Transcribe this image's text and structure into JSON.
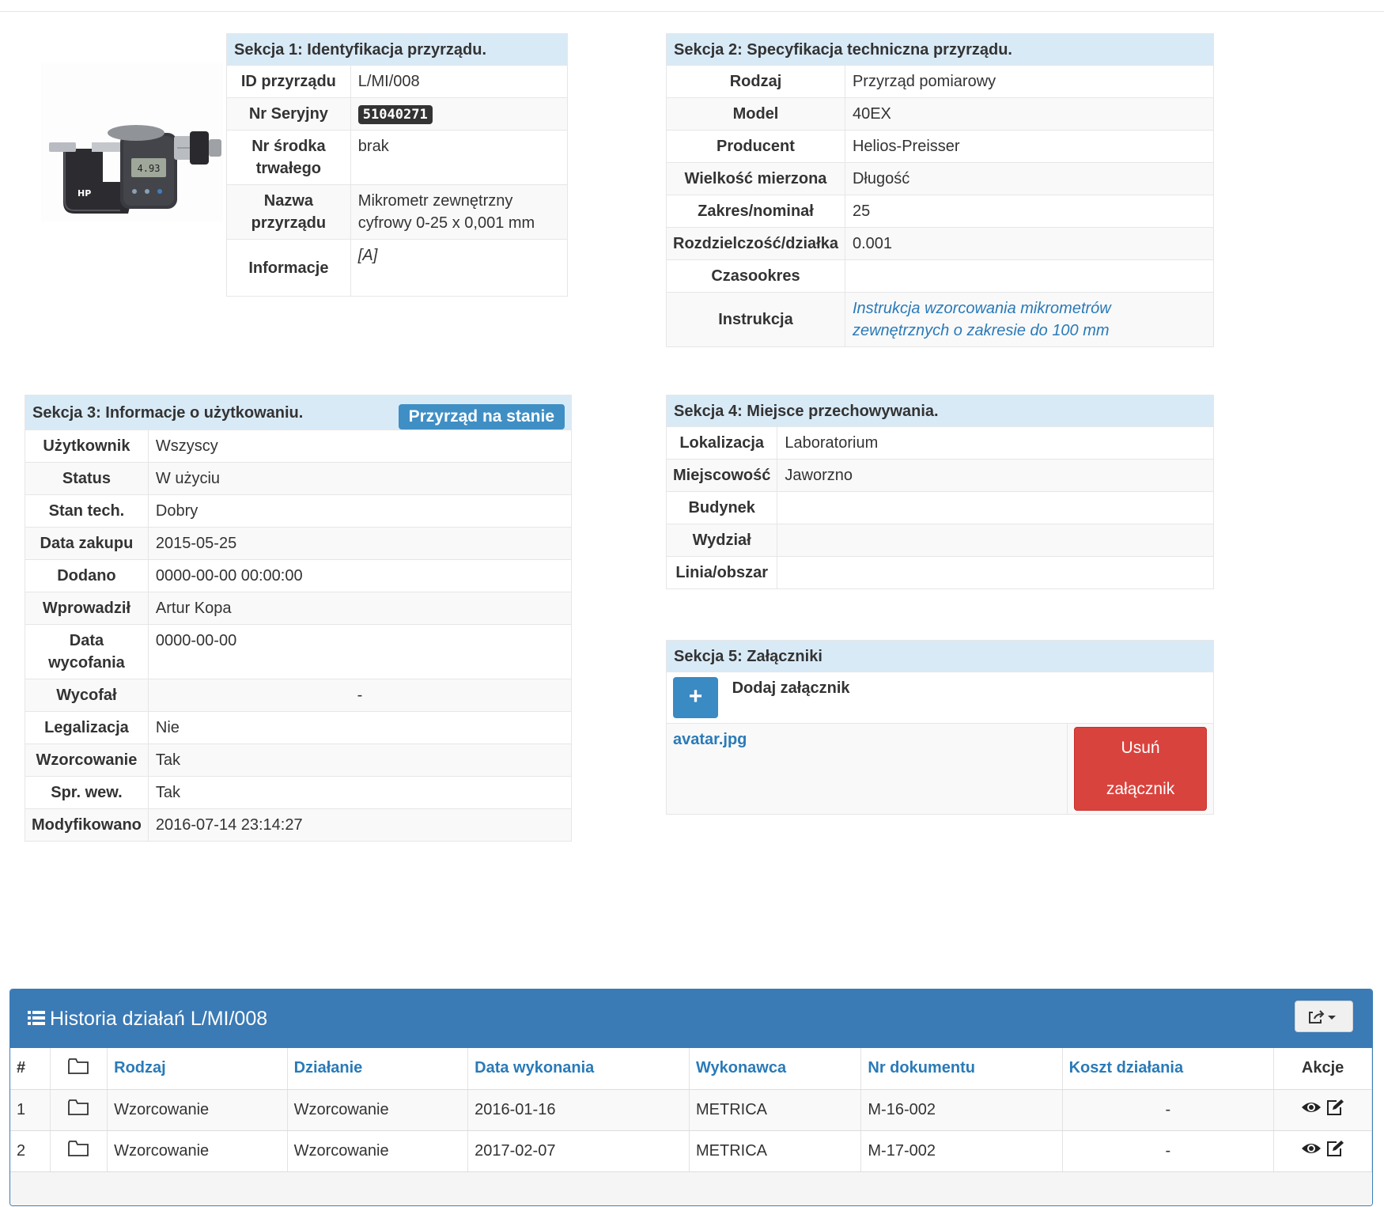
{
  "section1": {
    "title": "Sekcja 1: Identyfikacja przyrządu.",
    "rows": [
      {
        "label": "ID przyrządu",
        "value": "L/MI/008"
      },
      {
        "label": "Nr Seryjny",
        "value": "51040271"
      },
      {
        "label": "Nr środka trwałego",
        "value": "brak"
      },
      {
        "label": "Nazwa przyrządu",
        "value": "Mikrometr zewnętrzny cyfrowy 0-25 x 0,001 mm"
      },
      {
        "label": "Informacje",
        "value": "[A]"
      }
    ]
  },
  "section2": {
    "title": "Sekcja 2: Specyfikacja techniczna przyrządu.",
    "rows": [
      {
        "label": "Rodzaj",
        "value": "Przyrząd pomiarowy"
      },
      {
        "label": "Model",
        "value": "40EX"
      },
      {
        "label": "Producent",
        "value": "Helios-Preisser"
      },
      {
        "label": "Wielkość mierzona",
        "value": "Długość"
      },
      {
        "label": "Zakres/nominał",
        "value": "25"
      },
      {
        "label": "Rozdzielczość/działka",
        "value": "0.001"
      },
      {
        "label": "Czasookres",
        "value": ""
      },
      {
        "label": "Instrukcja",
        "value": "Instrukcja wzorcowania mikrometrów zewnętrznych o zakresie do 100 mm"
      }
    ]
  },
  "section3": {
    "title": "Sekcja 3: Informacje o użytkowaniu.",
    "badge": "Przyrząd na stanie",
    "rows": [
      {
        "label": "Użytkownik",
        "value": "Wszyscy"
      },
      {
        "label": "Status",
        "value": "W użyciu"
      },
      {
        "label": "Stan tech.",
        "value": "Dobry"
      },
      {
        "label": "Data zakupu",
        "value": "2015-05-25"
      },
      {
        "label": "Dodano",
        "value": "0000-00-00 00:00:00"
      },
      {
        "label": "Wprowadził",
        "value": "Artur Kopa"
      },
      {
        "label": "Data wycofania",
        "value": "0000-00-00"
      },
      {
        "label": "Wycofał",
        "value": "-"
      },
      {
        "label": "Legalizacja",
        "value": "Nie"
      },
      {
        "label": "Wzorcowanie",
        "value": "Tak"
      },
      {
        "label": "Spr. wew.",
        "value": "Tak"
      },
      {
        "label": "Modyfikowano",
        "value": "2016-07-14 23:14:27"
      }
    ]
  },
  "section4": {
    "title": "Sekcja 4: Miejsce przechowywania.",
    "rows": [
      {
        "label": "Lokalizacja",
        "value": "Laboratorium"
      },
      {
        "label": "Miejscowość",
        "value": "Jaworzno"
      },
      {
        "label": "Budynek",
        "value": ""
      },
      {
        "label": "Wydział",
        "value": ""
      },
      {
        "label": "Linia/obszar",
        "value": ""
      }
    ]
  },
  "section5": {
    "title": "Sekcja 5: Załączniki",
    "add_label": "Dodaj załącznik",
    "add_icon": "+",
    "file_name": "avatar.jpg",
    "delete_label": "Usuń załącznik"
  },
  "history": {
    "title": "Historia działań L/MI/008",
    "columns": [
      "#",
      "",
      "Rodzaj",
      "Działanie",
      "Data wykonania",
      "Wykonawca",
      "Nr dokumentu",
      "Koszt działania",
      "Akcje"
    ],
    "rows": [
      {
        "num": "1",
        "rodzaj": "Wzorcowanie",
        "dzialanie": "Wzorcowanie",
        "data": "2016-01-16",
        "wykonawca": "METRICA",
        "nr_dok": "M-16-002",
        "koszt": "-"
      },
      {
        "num": "2",
        "rodzaj": "Wzorcowanie",
        "dzialanie": "Wzorcowanie",
        "data": "2017-02-07",
        "wykonawca": "METRICA",
        "nr_dok": "M-17-002",
        "koszt": "-"
      }
    ]
  },
  "colors": {
    "section_header_bg": "#d9eaf7",
    "panel_blue": "#3a7ab5",
    "link_blue": "#2a7ab8",
    "danger_red": "#d9433e"
  }
}
